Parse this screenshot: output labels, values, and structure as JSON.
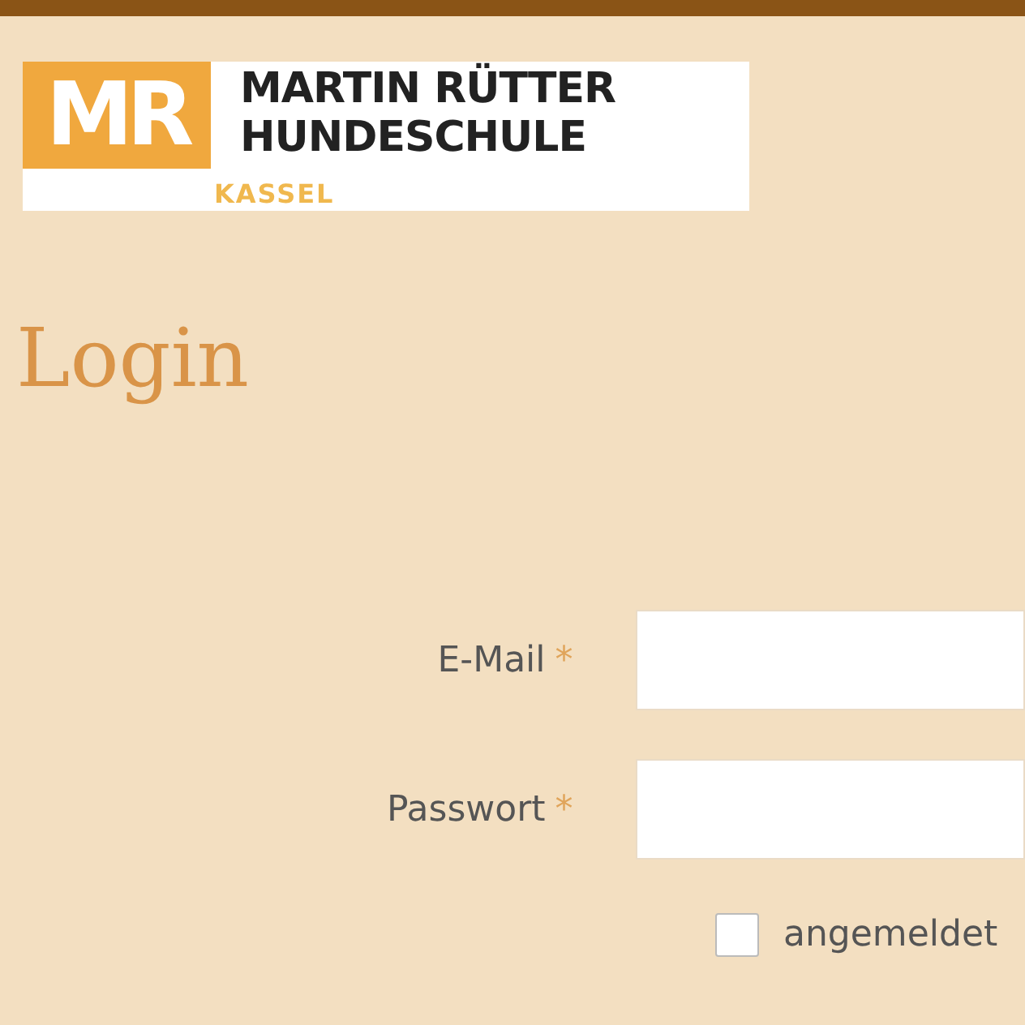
{
  "logo": {
    "mark": "MR",
    "name_line_1": "MARTIN RÜTTER",
    "name_line_2": "HUNDESCHULE",
    "city": "KASSEL"
  },
  "heading": "Login",
  "fields": [
    {
      "label": "E-Mail",
      "required_mark": "*"
    },
    {
      "label": "Passwort",
      "required_mark": "*"
    }
  ],
  "remember": {
    "label": "angemeldet",
    "checked": false
  }
}
